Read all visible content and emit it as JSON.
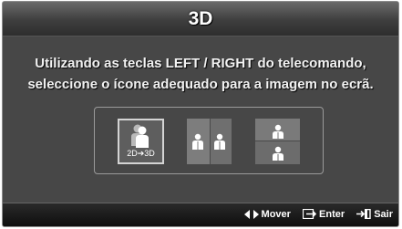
{
  "dialog": {
    "title": "3D",
    "instruction_line1": "Utilizando as teclas LEFT / RIGHT do telecomando,",
    "instruction_line2": "seleccione o ícone adequado para a imagem no ecrã."
  },
  "options": [
    {
      "icon": "2d-to-3d-icon",
      "label": "2D➔3D",
      "selected": true
    },
    {
      "icon": "side-by-side-icon",
      "label": ""
    },
    {
      "icon": "top-bottom-icon",
      "label": ""
    }
  ],
  "footer": {
    "move_label": "Mover",
    "move_icon": "left-right-arrows-icon",
    "enter_label": "Enter",
    "enter_icon": "enter-icon",
    "exit_label": "Sair",
    "exit_icon": "exit-icon"
  },
  "colors": {
    "background": "#474747",
    "title_bar": "#3e3e3e",
    "bottom_bar": "#141414",
    "text": "#ffffff"
  }
}
